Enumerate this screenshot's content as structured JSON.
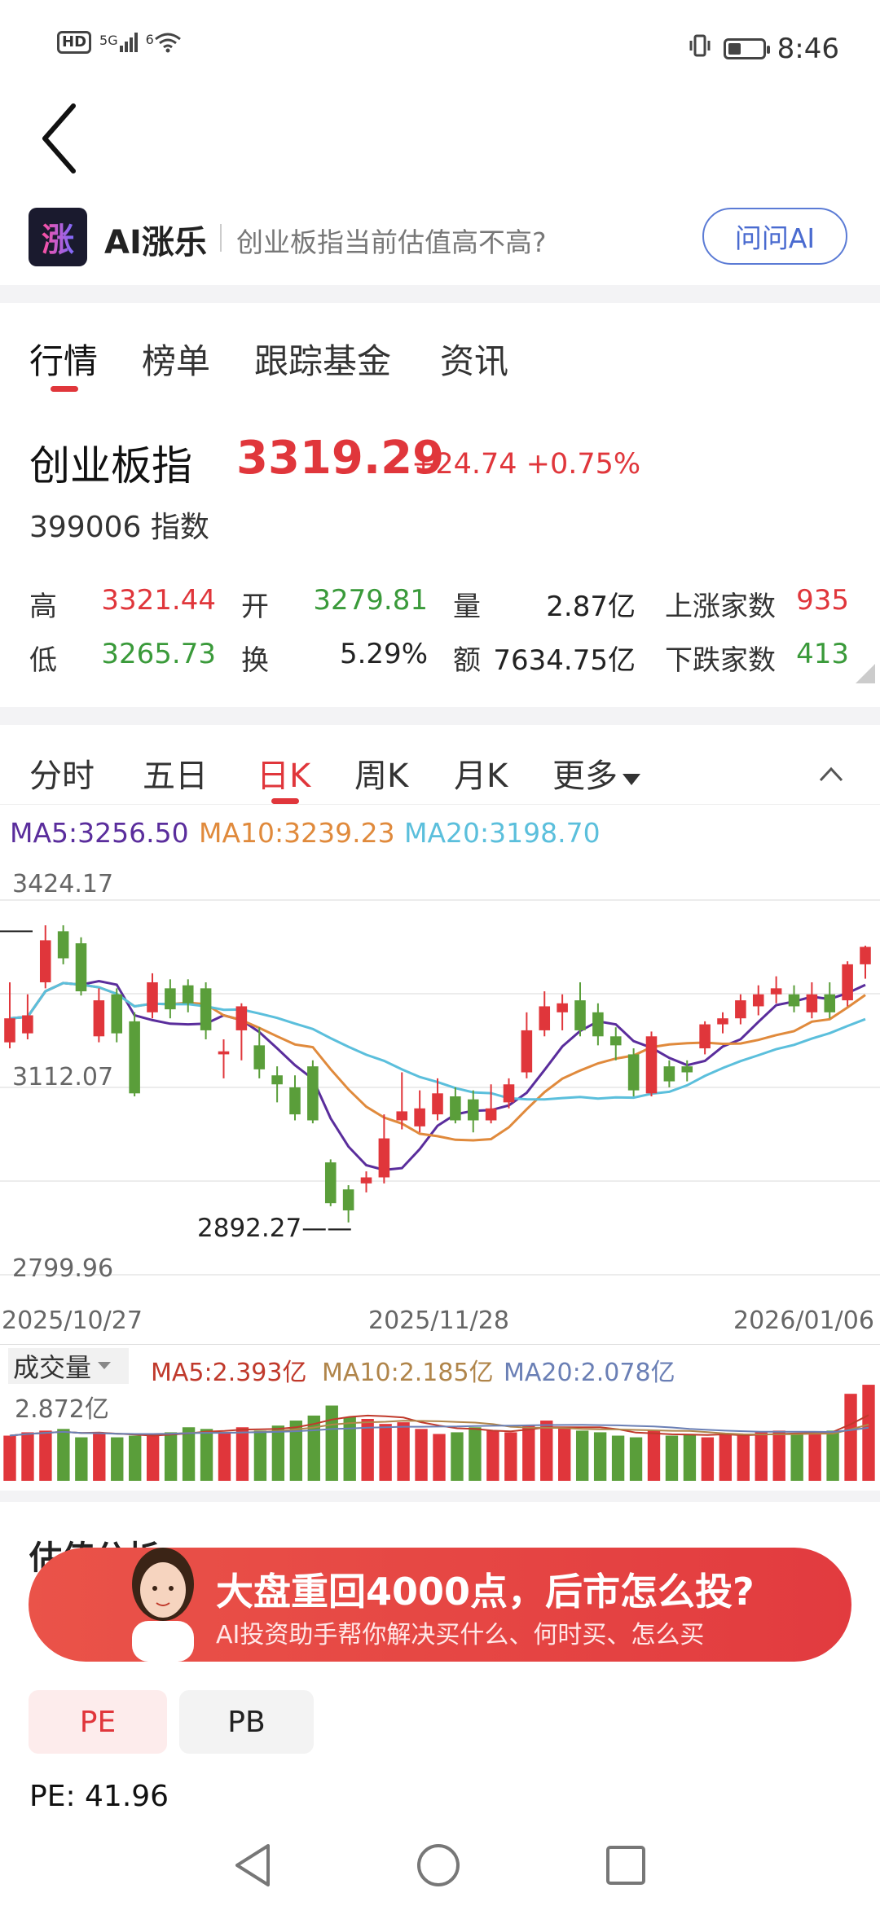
{
  "status_bar": {
    "network_badge": "HD",
    "signal_label": "5G",
    "wifi_label": "6",
    "time": "8:46",
    "battery_level": 0.35
  },
  "ai_bar": {
    "logo_char": "涨",
    "name": "AI涨乐",
    "question": "创业板指当前估值高不高?",
    "ask_button": "问问AI"
  },
  "main_tabs": [
    "行情",
    "榜单",
    "跟踪基金",
    "资讯"
  ],
  "quote": {
    "name": "创业板指",
    "price": "3319.29",
    "change": "+24.74",
    "change_pct": "+0.75%",
    "code": "399006",
    "type": "指数"
  },
  "stats": {
    "high_label": "高",
    "high": "3321.44",
    "open_label": "开",
    "open": "3279.81",
    "volume_label": "量",
    "volume": "2.87亿",
    "rise_label": "上涨家数",
    "rise": "935",
    "low_label": "低",
    "low": "3265.73",
    "turnover_label": "换",
    "turnover": "5.29%",
    "amount_label": "额",
    "amount": "7634.75亿",
    "fall_label": "下跌家数",
    "fall": "413"
  },
  "period_tabs": [
    "分时",
    "五日",
    "日K",
    "周K",
    "月K",
    "更多"
  ],
  "ma": {
    "ma5": "MA5:3256.50",
    "ma10": "MA10:3239.23",
    "ma20": "MA20:3198.70"
  },
  "colors": {
    "up": "#e0363b",
    "down": "#5a9e3a",
    "ma5": "#5a2d9c",
    "ma10": "#e08a3c",
    "ma20": "#5bbfdc"
  },
  "chart_data": {
    "type": "candlestick",
    "y_axis_labels": [
      "3424.17",
      "3112.07",
      "2799.96"
    ],
    "ylim": [
      2799.96,
      3424.17
    ],
    "low_annotation": "2892.27",
    "x_labels": [
      "2025/10/27",
      "2025/11/28",
      "2026/01/06"
    ],
    "candles": [
      {
        "o": 3160,
        "c": 3200,
        "h": 3260,
        "l": 3150
      },
      {
        "o": 3175,
        "c": 3205,
        "h": 3240,
        "l": 3165
      },
      {
        "o": 3260,
        "c": 3330,
        "h": 3355,
        "l": 3250
      },
      {
        "o": 3345,
        "c": 3300,
        "h": 3355,
        "l": 3290
      },
      {
        "o": 3325,
        "c": 3245,
        "h": 3335,
        "l": 3238
      },
      {
        "o": 3170,
        "c": 3230,
        "h": 3250,
        "l": 3160
      },
      {
        "o": 3240,
        "c": 3175,
        "h": 3250,
        "l": 3160
      },
      {
        "o": 3195,
        "c": 3075,
        "h": 3210,
        "l": 3070
      },
      {
        "o": 3210,
        "c": 3260,
        "h": 3275,
        "l": 3200
      },
      {
        "o": 3250,
        "c": 3215,
        "h": 3265,
        "l": 3200
      },
      {
        "o": 3255,
        "c": 3225,
        "h": 3265,
        "l": 3210
      },
      {
        "o": 3250,
        "c": 3180,
        "h": 3260,
        "l": 3165
      },
      {
        "o": 3140,
        "c": 3145,
        "h": 3165,
        "l": 3100
      },
      {
        "o": 3180,
        "c": 3220,
        "h": 3225,
        "l": 3130
      },
      {
        "o": 3155,
        "c": 3115,
        "h": 3185,
        "l": 3100
      },
      {
        "o": 3105,
        "c": 3090,
        "h": 3120,
        "l": 3060
      },
      {
        "o": 3085,
        "c": 3040,
        "h": 3105,
        "l": 3030
      },
      {
        "o": 3120,
        "c": 3030,
        "h": 3130,
        "l": 3025
      },
      {
        "o": 2960,
        "c": 2892,
        "h": 2965,
        "l": 2887
      },
      {
        "o": 2915,
        "c": 2880,
        "h": 2922,
        "l": 2860
      },
      {
        "o": 2925,
        "c": 2935,
        "h": 2945,
        "l": 2910
      },
      {
        "o": 2935,
        "c": 3000,
        "h": 3040,
        "l": 2925
      },
      {
        "o": 3030,
        "c": 3045,
        "h": 3110,
        "l": 3015
      },
      {
        "o": 3020,
        "c": 3050,
        "h": 3080,
        "l": 3010
      },
      {
        "o": 3040,
        "c": 3075,
        "h": 3100,
        "l": 3030
      },
      {
        "o": 3070,
        "c": 3030,
        "h": 3085,
        "l": 3025
      },
      {
        "o": 3065,
        "c": 3030,
        "h": 3080,
        "l": 3010
      },
      {
        "o": 3030,
        "c": 3050,
        "h": 3090,
        "l": 3025
      },
      {
        "o": 3060,
        "c": 3090,
        "h": 3100,
        "l": 3050
      },
      {
        "o": 3110,
        "c": 3180,
        "h": 3210,
        "l": 3100
      },
      {
        "o": 3180,
        "c": 3220,
        "h": 3245,
        "l": 3170
      },
      {
        "o": 3210,
        "c": 3225,
        "h": 3240,
        "l": 3180
      },
      {
        "o": 3230,
        "c": 3180,
        "h": 3260,
        "l": 3170
      },
      {
        "o": 3210,
        "c": 3170,
        "h": 3225,
        "l": 3155
      },
      {
        "o": 3170,
        "c": 3155,
        "h": 3185,
        "l": 3130
      },
      {
        "o": 3140,
        "c": 3080,
        "h": 3150,
        "l": 3070
      },
      {
        "o": 3075,
        "c": 3170,
        "h": 3178,
        "l": 3070
      },
      {
        "o": 3120,
        "c": 3095,
        "h": 3130,
        "l": 3085
      },
      {
        "o": 3120,
        "c": 3110,
        "h": 3130,
        "l": 3095
      },
      {
        "o": 3150,
        "c": 3190,
        "h": 3195,
        "l": 3140
      },
      {
        "o": 3190,
        "c": 3200,
        "h": 3210,
        "l": 3175
      },
      {
        "o": 3200,
        "c": 3230,
        "h": 3240,
        "l": 3190
      },
      {
        "o": 3220,
        "c": 3240,
        "h": 3255,
        "l": 3205
      },
      {
        "o": 3240,
        "c": 3250,
        "h": 3270,
        "l": 3225
      },
      {
        "o": 3240,
        "c": 3220,
        "h": 3255,
        "l": 3210
      },
      {
        "o": 3210,
        "c": 3240,
        "h": 3260,
        "l": 3200
      },
      {
        "o": 3240,
        "c": 3210,
        "h": 3260,
        "l": 3200
      },
      {
        "o": 3230,
        "c": 3290,
        "h": 3295,
        "l": 3220
      },
      {
        "o": 3290,
        "c": 3319,
        "h": 3321,
        "l": 3266
      }
    ]
  },
  "volume": {
    "label": "成交量",
    "ma5": "MA5:2.393亿",
    "ma10": "MA10:2.185亿",
    "ma20": "MA20:2.078亿",
    "max_label": "2.872亿",
    "max": 2.872,
    "values": [
      1.35,
      1.45,
      1.5,
      1.55,
      1.3,
      1.4,
      1.3,
      1.35,
      1.4,
      1.45,
      1.6,
      1.55,
      1.45,
      1.6,
      1.5,
      1.65,
      1.8,
      1.95,
      2.25,
      1.9,
      1.85,
      1.7,
      1.75,
      1.55,
      1.4,
      1.45,
      1.6,
      1.5,
      1.45,
      1.65,
      1.8,
      1.6,
      1.5,
      1.45,
      1.35,
      1.3,
      1.5,
      1.35,
      1.4,
      1.3,
      1.4,
      1.35,
      1.45,
      1.5,
      1.4,
      1.45,
      1.5,
      2.6,
      2.87
    ]
  },
  "valuation": {
    "section_title": "估值分析",
    "pe_tab": "PE",
    "pb_tab": "PB",
    "pe_value": "PE: 41.96"
  },
  "banner": {
    "title": "大盘重回4000点，后市怎么投?",
    "subtitle": "AI投资助手帮你解决买什么、何时买、怎么买"
  }
}
